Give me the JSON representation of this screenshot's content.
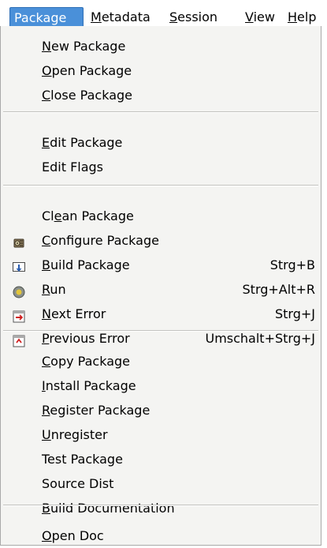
{
  "menubar": {
    "items": [
      {
        "label": "Package",
        "mnemonic": "P",
        "active": true
      },
      {
        "label": "Metadata",
        "mnemonic": "M"
      },
      {
        "label": "Session",
        "mnemonic": "S"
      },
      {
        "label": "View",
        "mnemonic": "V"
      },
      {
        "label": "Help",
        "mnemonic": "H"
      }
    ]
  },
  "menu": {
    "groups": [
      [
        {
          "label": "New Package",
          "mnemonic": "N"
        },
        {
          "label": "Open Package",
          "mnemonic": "O"
        },
        {
          "label": "Close Package",
          "mnemonic": "C"
        }
      ],
      [
        {
          "label": "Edit Package",
          "mnemonic": "E"
        },
        {
          "label": "Edit Flags",
          "mnemonic": ""
        }
      ],
      [
        {
          "label": "Clean Package",
          "mnemonic": "e",
          "mnemonic_index": 2
        },
        {
          "label": "Configure Package",
          "mnemonic": "C",
          "icon": "configure-icon"
        },
        {
          "label": "Build Package",
          "mnemonic": "B",
          "icon": "build-icon",
          "accelerator": "Strg+B"
        },
        {
          "label": "Run",
          "mnemonic": "R",
          "icon": "run-icon",
          "accelerator": "Strg+Alt+R"
        },
        {
          "label": "Next Error",
          "mnemonic": "N",
          "icon": "next-error-icon",
          "accelerator": "Strg+J"
        },
        {
          "label": "Previous Error",
          "mnemonic": "P",
          "icon": "previous-error-icon",
          "accelerator": "Umschalt+Strg+J"
        }
      ],
      [
        {
          "label": "Copy Package",
          "mnemonic": "C"
        },
        {
          "label": "Install Package",
          "mnemonic": "I"
        },
        {
          "label": "Register Package",
          "mnemonic": "R"
        },
        {
          "label": "Unregister",
          "mnemonic": "U"
        },
        {
          "label": "Test Package",
          "mnemonic": ""
        },
        {
          "label": "Source Dist",
          "mnemonic": ""
        },
        {
          "label": "Build Documentation",
          "mnemonic": "B"
        }
      ],
      [
        {
          "label": "Open Doc",
          "mnemonic": "O"
        }
      ]
    ]
  },
  "colors": {
    "menubar_active_bg": "#4a90d9",
    "menu_bg": "#f4f4f2",
    "separator": "#c2c2bf"
  }
}
